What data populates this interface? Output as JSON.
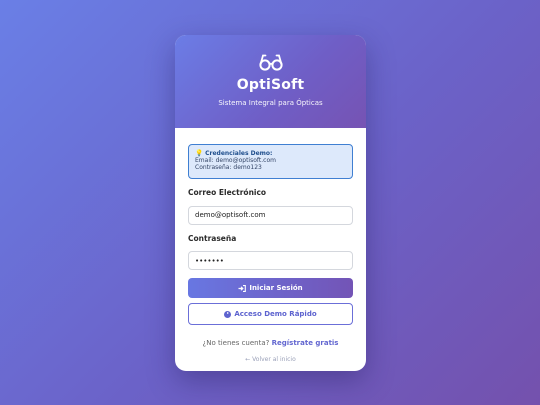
{
  "brand": {
    "logo_icon": "glasses-icon",
    "name": "OptiSoft",
    "tagline": "Sistema Integral para Ópticas"
  },
  "demo": {
    "icon": "lightbulb-icon",
    "title": "Credenciales Demo:",
    "email_line": "Email: demo@optisoft.com",
    "password_line": "Contraseña: demo123"
  },
  "form": {
    "email_label": "Correo Electrónico",
    "email_value": "demo@optisoft.com",
    "password_label": "Contraseña",
    "password_value": "demo123"
  },
  "buttons": {
    "login_icon": "sign-in-icon",
    "login_label": "Iniciar Sesión",
    "demo_icon": "play-circle-icon",
    "demo_label": "Acceso Demo Rápido"
  },
  "footer": {
    "no_account_text": "¿No tienes cuenta?",
    "signup_label": "Regístrate gratis",
    "back_label": "← Volver al inicio"
  },
  "colors": {
    "accent": "#6b6fd8",
    "demo_box_bg": "#dde9fb",
    "demo_box_border": "#3f7fd2"
  }
}
